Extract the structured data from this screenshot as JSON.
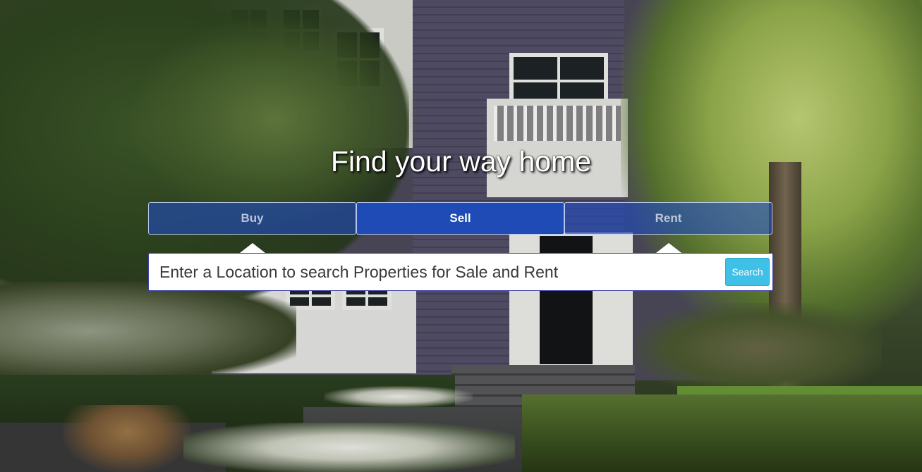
{
  "hero": {
    "headline": "Find your way home"
  },
  "tabs": [
    {
      "label": "Buy",
      "active": false
    },
    {
      "label": "Sell",
      "active": true
    },
    {
      "label": "Rent",
      "active": false
    }
  ],
  "search": {
    "placeholder": "Enter a Location to search Properties for Sale and Rent",
    "value": "",
    "button_label": "Search"
  },
  "colors": {
    "tab_active": "#1e4bb5",
    "tab_inactive": "#204abe",
    "search_button": "#3fc0e6",
    "headline": "#ffffff"
  }
}
